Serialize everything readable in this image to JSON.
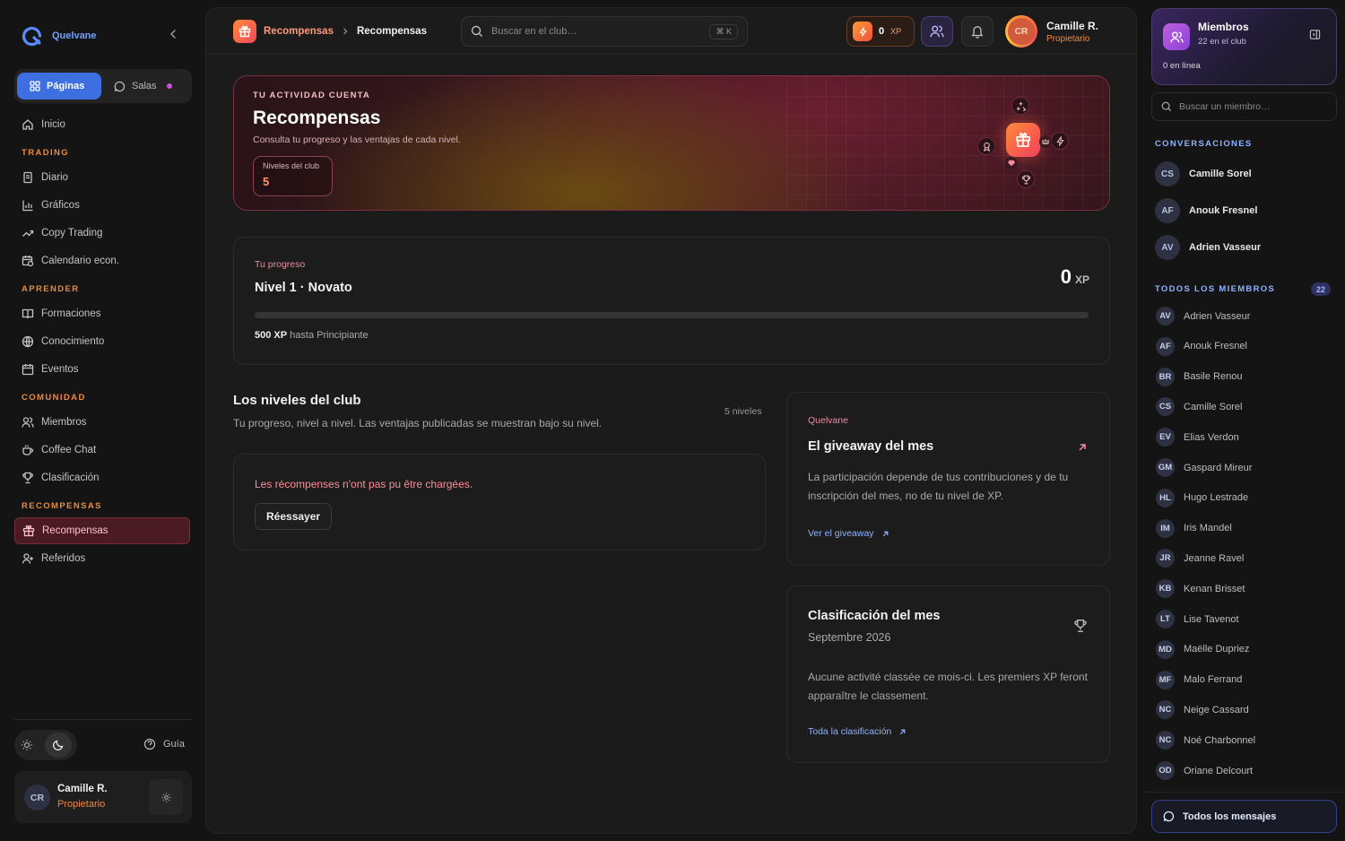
{
  "brand": {
    "name": "Quelvane"
  },
  "sidebar": {
    "tabs": {
      "pages": "Páginas",
      "rooms": "Salas"
    },
    "home": "Inicio",
    "sections": [
      {
        "title": "TRADING",
        "items": [
          "Diario",
          "Gráficos",
          "Copy Trading",
          "Calendario econ."
        ]
      },
      {
        "title": "APRENDER",
        "items": [
          "Formaciones",
          "Conocimiento",
          "Eventos"
        ]
      },
      {
        "title": "COMUNIDAD",
        "items": [
          "Miembros",
          "Coffee Chat",
          "Clasificación"
        ]
      },
      {
        "title": "RECOMPENSAS",
        "items": [
          "Recompensas",
          "Referidos"
        ]
      }
    ],
    "active_item": "Recompensas",
    "guide": "Guía",
    "user": {
      "initials": "CR",
      "name": "Camille R.",
      "role": "Propietario"
    }
  },
  "topbar": {
    "breadcrumb": [
      "Recompensas",
      "Recompensas"
    ],
    "search_placeholder": "Buscar en el club…",
    "shortcut": "⌘ K",
    "xp_value": "0",
    "xp_unit": "XP",
    "profile": {
      "initials": "CR",
      "name": "Camille R.",
      "role": "Propietario"
    }
  },
  "hero": {
    "kicker": "TU ACTIVIDAD CUENTA",
    "title": "Recompensas",
    "subtitle": "Consulta tu progreso y las ventajas de cada nivel.",
    "stat_label": "Niveles del club",
    "stat_value": "5"
  },
  "progress": {
    "label": "Tu progreso",
    "level": "Nivel 1 · Novato",
    "xp": "0",
    "xp_unit": "XP",
    "fraction": 0,
    "remaining_xp": "500 XP",
    "remaining_text": "hasta Principiante"
  },
  "levels": {
    "title": "Los niveles del club",
    "subtitle": "Tu progreso, nivel a nivel. Las ventajas publicadas se muestran bajo su nivel.",
    "count": "5 niveles",
    "error": "Les récompenses n'ont pas pu être chargées.",
    "retry": "Réessayer"
  },
  "giveaway": {
    "kicker": "Quelvane",
    "title": "El giveaway del mes",
    "text": "La participación depende de tus contribuciones y de tu inscripción del mes, no de tu nivel de XP.",
    "link": "Ver el giveaway"
  },
  "ranking": {
    "title": "Clasificación del mes",
    "period": "Septembre 2026",
    "text": "Aucune activité classée ce mois-ci. Les premiers XP feront apparaître le classement.",
    "link": "Toda la clasificación"
  },
  "members_panel": {
    "title": "Miembros",
    "count_text": "22 en el club",
    "online_text": "0 en línea",
    "search_placeholder": "Buscar un miembro…",
    "conversations_title": "CONVERSACIONES",
    "conversations": [
      {
        "initials": "CS",
        "name": "Camille Sorel"
      },
      {
        "initials": "AF",
        "name": "Anouk Fresnel"
      },
      {
        "initials": "AV",
        "name": "Adrien Vasseur"
      }
    ],
    "all_title": "TODOS LOS MIEMBROS",
    "all_count": "22",
    "members": [
      {
        "initials": "AV",
        "name": "Adrien Vasseur"
      },
      {
        "initials": "AF",
        "name": "Anouk Fresnel"
      },
      {
        "initials": "BR",
        "name": "Basile Renou"
      },
      {
        "initials": "CS",
        "name": "Camille Sorel"
      },
      {
        "initials": "EV",
        "name": "Elias Verdon"
      },
      {
        "initials": "GM",
        "name": "Gaspard Mireur"
      },
      {
        "initials": "HL",
        "name": "Hugo Lestrade"
      },
      {
        "initials": "IM",
        "name": "Iris Mandel"
      },
      {
        "initials": "JR",
        "name": "Jeanne Ravel"
      },
      {
        "initials": "KB",
        "name": "Kenan Brisset"
      },
      {
        "initials": "LT",
        "name": "Lise Tavenot"
      },
      {
        "initials": "MD",
        "name": "Maëlle Dupriez"
      },
      {
        "initials": "MF",
        "name": "Malo Ferrand"
      },
      {
        "initials": "NC",
        "name": "Neige Cassard"
      },
      {
        "initials": "NC",
        "name": "Noé Charbonnel"
      },
      {
        "initials": "OD",
        "name": "Oriane Delcourt"
      }
    ],
    "all_messages": "Todos los mensajes"
  }
}
